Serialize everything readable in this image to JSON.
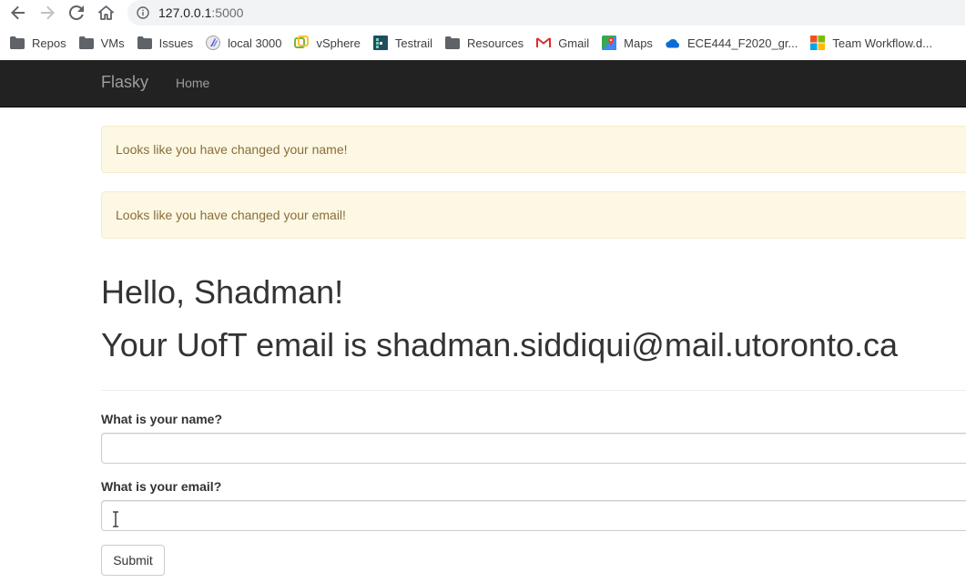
{
  "browser": {
    "url_host": "127.0.0.1",
    "url_port": ":5000",
    "bookmarks": [
      {
        "label": "Repos",
        "icon": "folder-icon"
      },
      {
        "label": "VMs",
        "icon": "folder-icon"
      },
      {
        "label": "Issues",
        "icon": "folder-icon"
      },
      {
        "label": "local 3000",
        "icon": "local-site-icon"
      },
      {
        "label": "vSphere",
        "icon": "vsphere-icon"
      },
      {
        "label": "Testrail",
        "icon": "testrail-icon"
      },
      {
        "label": "Resources",
        "icon": "folder-icon"
      },
      {
        "label": "Gmail",
        "icon": "gmail-icon"
      },
      {
        "label": "Maps",
        "icon": "maps-icon"
      },
      {
        "label": "ECE444_F2020_gr...",
        "icon": "onedrive-icon"
      },
      {
        "label": "Team Workflow.d...",
        "icon": "office-icon"
      }
    ]
  },
  "navbar": {
    "brand": "Flasky",
    "home": "Home"
  },
  "alerts": [
    "Looks like you have changed your name!",
    "Looks like you have changed your email!"
  ],
  "page": {
    "greeting": "Hello, Shadman!",
    "email_line": "Your UofT email is shadman.siddiqui@mail.utoronto.ca"
  },
  "form": {
    "name_label": "What is your name?",
    "name_value": "",
    "email_label": "What is your email?",
    "email_value": "",
    "submit_label": "Submit"
  },
  "colors": {
    "navbar_bg": "#222222",
    "alert_bg": "#fcf8e3",
    "alert_text": "#8a6d3b"
  }
}
